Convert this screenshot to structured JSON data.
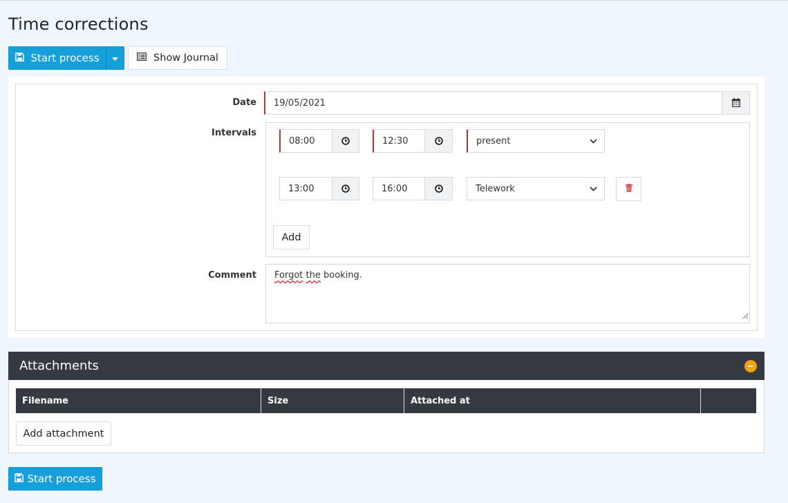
{
  "page": {
    "title": "Time corrections"
  },
  "toolbar": {
    "start_process_label": "Start process",
    "show_journal_label": "Show Journal"
  },
  "form": {
    "date_label": "Date",
    "date_value": "19/05/2021",
    "intervals_label": "Intervals",
    "intervals": [
      {
        "from": "08:00",
        "to": "12:30",
        "type": "present"
      },
      {
        "from": "13:00",
        "to": "16:00",
        "type": "Telework"
      }
    ],
    "add_label": "Add",
    "comment_label": "Comment",
    "comment_word1": "Forgot",
    "comment_word2": "the",
    "comment_rest": "booking."
  },
  "attachments": {
    "title": "Attachments",
    "columns": [
      "Filename",
      "Size",
      "Attached at",
      ""
    ],
    "add_label": "Add attachment"
  },
  "footer": {
    "start_process_label": "Start process"
  },
  "colors": {
    "primary": "#15a0db",
    "dark_header": "#343a40",
    "required_marker": "#a33a3a",
    "collapse_badge": "#f0a30a",
    "delete_icon": "#dc3545"
  }
}
